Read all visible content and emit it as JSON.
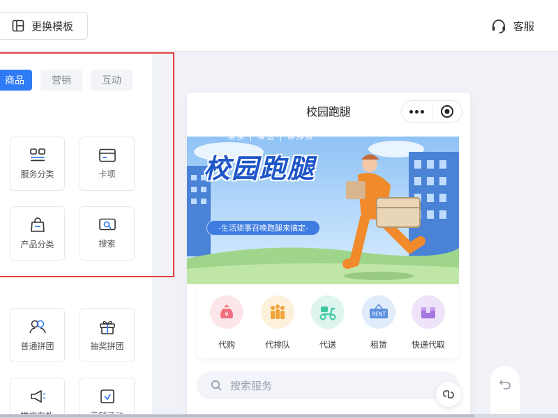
{
  "toolbar": {
    "template_label": "更换模板",
    "service_label": "客服"
  },
  "tabs": [
    {
      "label": "商品",
      "active": true
    },
    {
      "label": "营销",
      "active": false
    },
    {
      "label": "互动",
      "active": false
    }
  ],
  "components": [
    {
      "label": "服务分类",
      "icon": "grid-icon"
    },
    {
      "label": "卡项",
      "icon": "card-icon"
    },
    {
      "label": "产品分类",
      "icon": "bag-icon"
    },
    {
      "label": "搜索",
      "icon": "search-box-icon"
    },
    {
      "label": "普通拼团",
      "icon": "group-icon"
    },
    {
      "label": "抽奖拼团",
      "icon": "gift-icon"
    },
    {
      "label": "推广有礼",
      "icon": "megaphone-icon"
    },
    {
      "label": "营销活动",
      "icon": "event-icon"
    }
  ],
  "phone": {
    "title": "校园跑腿",
    "banner": {
      "tagline": "帮买 | 帮送 | 帮排队",
      "headline": "校园跑腿",
      "subline": "-生活琐事召唤跑腿来搞定-"
    },
    "services": [
      {
        "label": "代购",
        "icon": "money-bag-icon",
        "color": "#fde6ea",
        "accent": "#f0707f"
      },
      {
        "label": "代排队",
        "icon": "queue-icon",
        "color": "#fdf1dc",
        "accent": "#f2a43a"
      },
      {
        "label": "代送",
        "icon": "scooter-icon",
        "color": "#dcf5ee",
        "accent": "#3cc7a0"
      },
      {
        "label": "租赁",
        "icon": "rent-sign-icon",
        "color": "#e1ecfb",
        "accent": "#5b8fe0"
      },
      {
        "label": "快递代取",
        "icon": "package-icon",
        "color": "#efe3fa",
        "accent": "#a777e0"
      }
    ],
    "search_placeholder": "搜索服务"
  },
  "colors": {
    "accent": "#2f7bf5",
    "highlight": "#e53e3e"
  }
}
